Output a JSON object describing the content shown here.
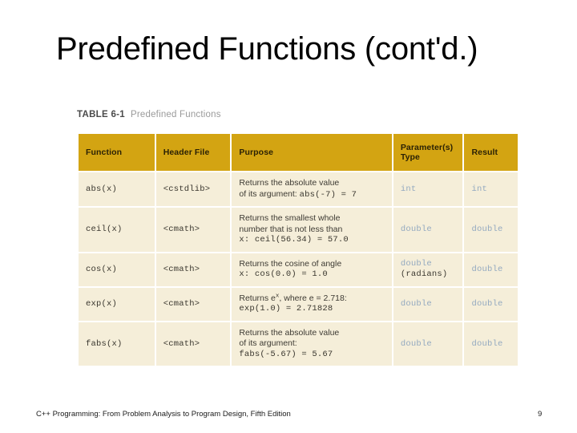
{
  "slide": {
    "title": "Predefined Functions (cont'd.)",
    "footer": "C++ Programming: From Problem Analysis to Program Design, Fifth Edition",
    "page_number": "9"
  },
  "table": {
    "caption_label": "TABLE 6-1",
    "caption_title": "Predefined Functions",
    "header_color": "#d3a412",
    "cell_color": "#f5eed9",
    "type_text_color": "#93a9c0",
    "columns": [
      "Function",
      "Header File",
      "Purpose",
      "Parameter(s) Type",
      "Result"
    ],
    "headers": {
      "function": "Function",
      "header_file": "Header File",
      "purpose": "Purpose",
      "parameter_type_line1": "Parameter(s)",
      "parameter_type_line2": "Type",
      "result": "Result"
    },
    "rows": [
      {
        "function": "abs(x)",
        "header_file": "<cstdlib>",
        "purpose_line1": "Returns the absolute value",
        "purpose_line2_text": "of its argument: ",
        "purpose_line2_code": "abs(-7) = 7",
        "purpose_line3": "",
        "parameter_type": "int",
        "parameter_type_note": "",
        "result": "int"
      },
      {
        "function": "ceil(x)",
        "header_file": "<cmath>",
        "purpose_line1": "Returns the smallest whole",
        "purpose_line2_text": "number that is not less than",
        "purpose_line2_code": "",
        "purpose_line3": "x: ceil(56.34) = 57.0",
        "parameter_type": "double",
        "parameter_type_note": "",
        "result": "double"
      },
      {
        "function": "cos(x)",
        "header_file": "<cmath>",
        "purpose_line1": "Returns the cosine of angle",
        "purpose_line2_text": "",
        "purpose_line2_code": "",
        "purpose_line3": "x: cos(0.0) = 1.0",
        "parameter_type": "double",
        "parameter_type_note": "(radians)",
        "result": "double"
      },
      {
        "function": "exp(x)",
        "header_file": "<cmath>",
        "purpose_line1": "Returns e^x, where e = 2.718:",
        "purpose_line2_text": "",
        "purpose_line2_code": "",
        "purpose_line3": "exp(1.0) = 2.71828",
        "parameter_type": "double",
        "parameter_type_note": "",
        "result": "double"
      },
      {
        "function": "fabs(x)",
        "header_file": "<cmath>",
        "purpose_line1": "Returns the absolute value",
        "purpose_line2_text": "of its argument:",
        "purpose_line2_code": "",
        "purpose_line3": "fabs(-5.67) = 5.67",
        "parameter_type": "double",
        "parameter_type_note": "",
        "result": "double"
      }
    ],
    "exp_row_prefix": "Returns e",
    "exp_row_superscript": "x",
    "exp_row_suffix": ", where e = 2.718:"
  }
}
